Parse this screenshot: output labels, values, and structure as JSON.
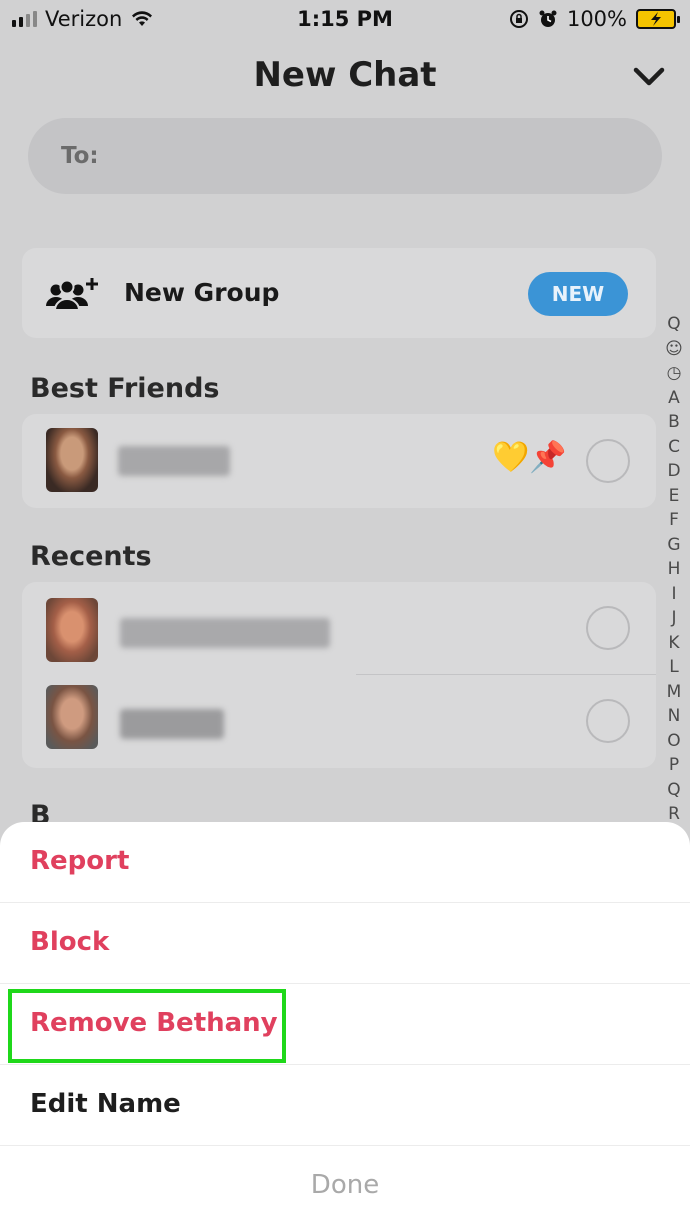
{
  "status_bar": {
    "carrier": "Verizon",
    "time": "1:15 PM",
    "battery_percent": "100%"
  },
  "header": {
    "title": "New Chat"
  },
  "to_field": {
    "placeholder": "To:"
  },
  "new_group": {
    "label": "New Group",
    "badge": "NEW"
  },
  "sections": {
    "best_friends": "Best Friends",
    "recents": "Recents",
    "next_letter": "B"
  },
  "alpha_index": [
    "Q",
    "☺",
    "◷",
    "A",
    "B",
    "C",
    "D",
    "E",
    "F",
    "G",
    "H",
    "I",
    "J",
    "K",
    "L",
    "M",
    "N",
    "O",
    "P",
    "Q",
    "R"
  ],
  "best_friend_row": {
    "name": "Bethany",
    "emojis": "💛📌"
  },
  "sheet": {
    "items": [
      {
        "label": "Report",
        "style": "danger"
      },
      {
        "label": "Block",
        "style": "danger"
      },
      {
        "label": "Remove Bethany",
        "style": "danger"
      },
      {
        "label": "Edit Name",
        "style": "normal"
      }
    ],
    "done_label": "Done"
  },
  "colors": {
    "danger": "#e0405e",
    "badge_blue": "#3b94d6",
    "highlight_green": "#1fd81a"
  }
}
